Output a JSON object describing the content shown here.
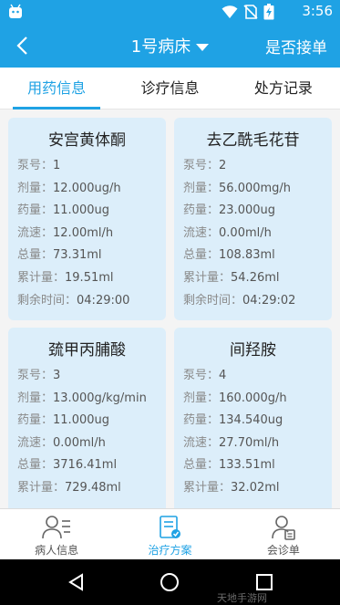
{
  "status_bar": {
    "time": "3:56"
  },
  "app_bar": {
    "title": "1号病床",
    "action": "是否接单"
  },
  "tabs": [
    {
      "label": "用药信息",
      "active": true
    },
    {
      "label": "诊疗信息",
      "active": false
    },
    {
      "label": "处方记录",
      "active": false
    }
  ],
  "cards": [
    {
      "name": "安宫黄体酮",
      "rows": [
        {
          "k": "泵号：",
          "v": "1"
        },
        {
          "k": "剂量：",
          "v": "12.000ug/h"
        },
        {
          "k": "药量：",
          "v": "11.000ug"
        },
        {
          "k": "流速：",
          "v": "12.00ml/h"
        },
        {
          "k": "总量：",
          "v": "73.31ml"
        },
        {
          "k": "累计量：",
          "v": "19.51ml"
        },
        {
          "k": "剩余时间：",
          "v": "04:29:00"
        }
      ]
    },
    {
      "name": "去乙酰毛花苷",
      "rows": [
        {
          "k": "泵号：",
          "v": "2"
        },
        {
          "k": "剂量：",
          "v": "56.000mg/h"
        },
        {
          "k": "药量：",
          "v": "23.000ug"
        },
        {
          "k": "流速：",
          "v": "0.00ml/h"
        },
        {
          "k": "总量：",
          "v": "108.83ml"
        },
        {
          "k": "累计量：",
          "v": "54.26ml"
        },
        {
          "k": "剩余时间：",
          "v": "04:29:02"
        }
      ]
    },
    {
      "name": "巯甲丙脯酸",
      "rows": [
        {
          "k": "泵号：",
          "v": "3"
        },
        {
          "k": "剂量：",
          "v": "13.000g/kg/min"
        },
        {
          "k": "药量：",
          "v": "11.000ug"
        },
        {
          "k": "流速：",
          "v": "0.00ml/h"
        },
        {
          "k": "总量：",
          "v": "3716.41ml"
        },
        {
          "k": "累计量：",
          "v": "729.48ml"
        }
      ]
    },
    {
      "name": "间羟胺",
      "rows": [
        {
          "k": "泵号：",
          "v": "4"
        },
        {
          "k": "剂量：",
          "v": "160.000g/h"
        },
        {
          "k": "药量：",
          "v": "134.540ug"
        },
        {
          "k": "流速：",
          "v": "27.70ml/h"
        },
        {
          "k": "总量：",
          "v": "133.51ml"
        },
        {
          "k": "累计量：",
          "v": "32.02ml"
        }
      ]
    }
  ],
  "bottom_nav": [
    {
      "label": "病人信息",
      "icon": "patient-icon",
      "active": false
    },
    {
      "label": "治疗方案",
      "icon": "treatment-plan-icon",
      "active": true
    },
    {
      "label": "会诊单",
      "icon": "consultation-icon",
      "active": false
    }
  ],
  "watermark": "天地手游网",
  "colors": {
    "primary": "#1fa2e4",
    "card_bg": "#dceefa"
  }
}
